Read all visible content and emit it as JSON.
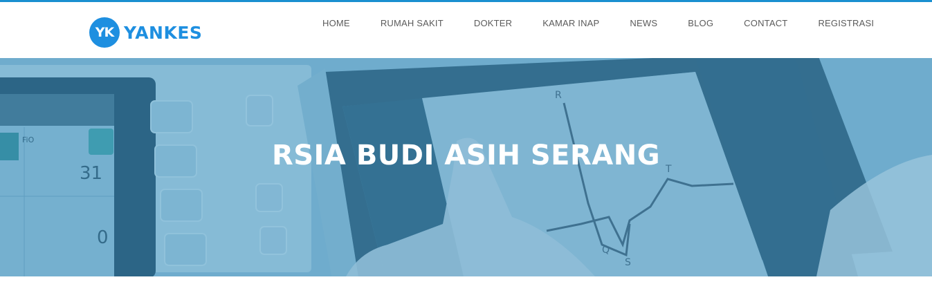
{
  "brand": {
    "badge": "YK",
    "name": "YANKES",
    "color": "#1e8fe0"
  },
  "nav": {
    "items": [
      {
        "label": "HOME"
      },
      {
        "label": "RUMAH SAKIT"
      },
      {
        "label": "DOKTER"
      },
      {
        "label": "KAMAR INAP"
      },
      {
        "label": "NEWS"
      },
      {
        "label": "BLOG"
      },
      {
        "label": "CONTACT"
      },
      {
        "label": "REGISTRASI"
      }
    ]
  },
  "hero": {
    "title": "RSIA BUDI ASIH SERANG",
    "overlay_color": "#4a96c3"
  }
}
